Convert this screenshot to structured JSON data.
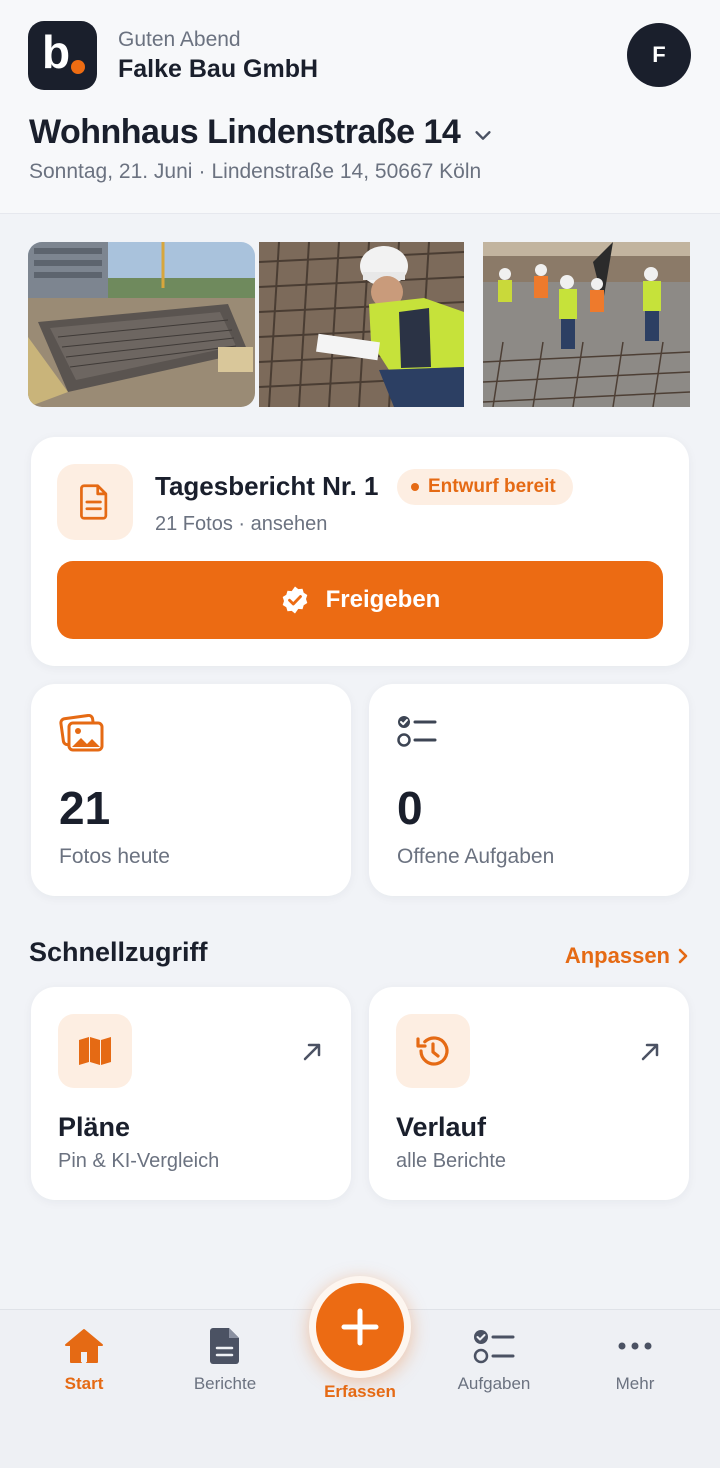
{
  "header": {
    "logo_letter": "b",
    "greeting": "Guten Abend",
    "company": "Falke Bau GmbH",
    "avatar_initial": "F"
  },
  "project": {
    "title": "Wohnhaus Lindenstraße 14",
    "date": "Sonntag, 21. Juni",
    "separator": "·",
    "address": "Lindenstraße 14, 50667 Köln"
  },
  "photos": [
    {
      "subject": "construction-site-foundation-photo"
    },
    {
      "subject": "worker-inspecting-rebar-photo"
    },
    {
      "subject": "workers-pouring-concrete-photo"
    }
  ],
  "report": {
    "title": "Tagesbericht Nr. 1",
    "badge": "Entwurf bereit",
    "subtitle": "21 Fotos · ansehen",
    "approve_label": "Freigeben"
  },
  "stats": {
    "photos_value": "21",
    "photos_label": "Fotos heute",
    "tasks_value": "0",
    "tasks_label": "Offene Aufgaben"
  },
  "quick_access": {
    "title": "Schnellzugriff",
    "customize": "Anpassen",
    "items": [
      {
        "title": "Pläne",
        "subtitle": "Pin & KI-Vergleich",
        "icon": "map-icon"
      },
      {
        "title": "Verlauf",
        "subtitle": "alle Berichte",
        "icon": "history-icon"
      }
    ]
  },
  "nav": {
    "start": "Start",
    "reports": "Berichte",
    "capture": "Erfassen",
    "tasks": "Aufgaben",
    "more": "Mehr"
  },
  "colors": {
    "accent": "#ec6b13",
    "dark": "#1a1f2c",
    "muted": "#6b7280",
    "tile": "#fdeee2"
  }
}
